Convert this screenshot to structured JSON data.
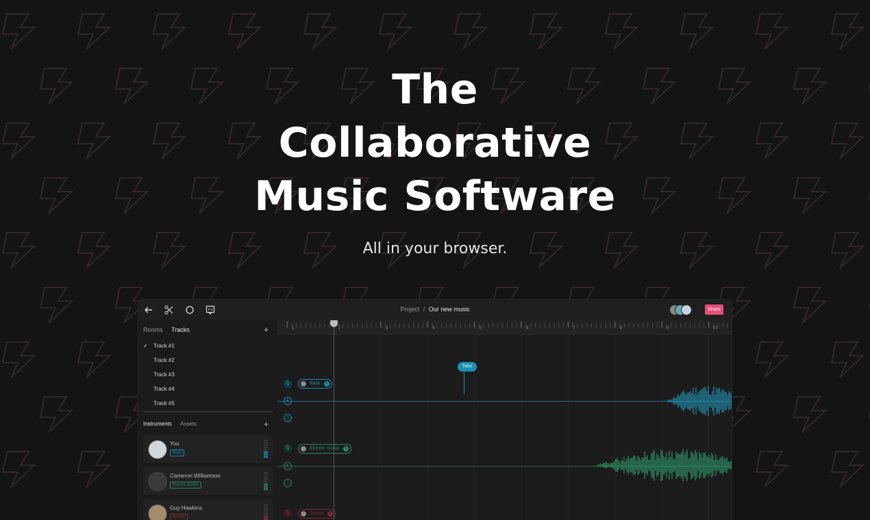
{
  "hero": {
    "title_line1": "The",
    "title_line2": "Collaborative",
    "title_line3": "Music Software",
    "subtitle": "All in your browser."
  },
  "toolbar": {
    "back_icon": "arrow-left-icon",
    "cut_icon": "scissors-icon",
    "record_icon": "circle-icon",
    "comment_icon": "comment-icon",
    "breadcrumb_parent": "Project",
    "breadcrumb_separator": "/",
    "breadcrumb_current": "Our new music",
    "share_label": "Share"
  },
  "sidebar": {
    "tabs": [
      "Rooms",
      "Tracks"
    ],
    "active_tab": "Tracks",
    "tracks": [
      {
        "label": "Track #1",
        "checked": true
      },
      {
        "label": "Track #2",
        "checked": false
      },
      {
        "label": "Track #3",
        "checked": false
      },
      {
        "label": "Track #4",
        "checked": false
      },
      {
        "label": "Track #5",
        "checked": false
      }
    ],
    "instrument_tabs": [
      "Instruments",
      "Assets"
    ],
    "instruments": [
      {
        "name": "You",
        "tag": "Bass",
        "color": "#1b8fb3"
      },
      {
        "name": "Cameron Williamson",
        "tag": "Electric Guitar",
        "color": "#2d8a62"
      },
      {
        "name": "Guy Hawkins",
        "tag": "Drums",
        "color": "#8a2b35"
      }
    ]
  },
  "timeline": {
    "ruler": [
      "1",
      "2",
      "3",
      "4",
      "5",
      "6",
      "7",
      "8",
      "9",
      "10"
    ],
    "take_label": "Take",
    "tracks": [
      {
        "label": "Bass",
        "color": "#1b8fb3"
      },
      {
        "label": "Electric Guitar",
        "color": "#2d8a62"
      },
      {
        "label": "Drums",
        "color": "#8a2b35"
      }
    ]
  },
  "colors": {
    "background": "#141414",
    "accent_blue": "#1b8fb3",
    "accent_green": "#2d8a62",
    "accent_red": "#8a2b35",
    "share": "#e34e7a"
  }
}
